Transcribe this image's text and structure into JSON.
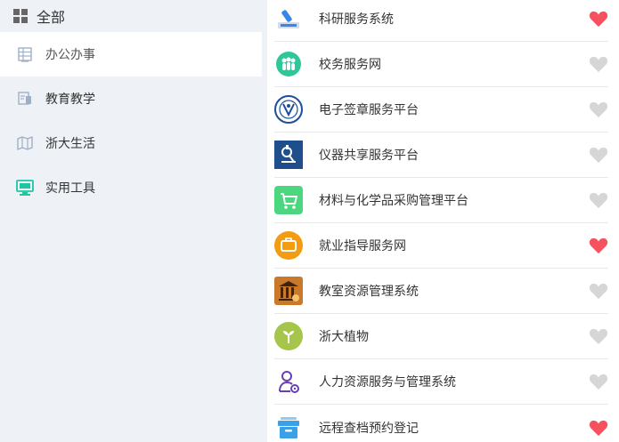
{
  "sidebar": {
    "all_label": "全部",
    "items": [
      {
        "label": "办公办事",
        "icon": "table-icon",
        "active": true
      },
      {
        "label": "教育教学",
        "icon": "board-icon",
        "active": false
      },
      {
        "label": "浙大生活",
        "icon": "map-icon",
        "active": false
      },
      {
        "label": "实用工具",
        "icon": "monitor-tool-icon",
        "active": false
      }
    ]
  },
  "services": [
    {
      "name": "科研服务系统",
      "icon": "microscope-icon",
      "favorited": true
    },
    {
      "name": "校务服务网",
      "icon": "people-circle-icon",
      "favorited": false
    },
    {
      "name": "电子签章服务平台",
      "icon": "university-seal-icon",
      "favorited": false
    },
    {
      "name": "仪器共享服务平台",
      "icon": "microscope-square-icon",
      "favorited": false
    },
    {
      "name": "材料与化学品采购管理平台",
      "icon": "cart-icon",
      "favorited": false
    },
    {
      "name": "就业指导服务网",
      "icon": "briefcase-icon",
      "favorited": true
    },
    {
      "name": "教室资源管理系统",
      "icon": "classroom-icon",
      "favorited": false
    },
    {
      "name": "浙大植物",
      "icon": "sprout-icon",
      "favorited": false
    },
    {
      "name": "人力资源服务与管理系统",
      "icon": "person-gear-icon",
      "favorited": false
    },
    {
      "name": "远程查档预约登记",
      "icon": "archive-box-icon",
      "favorited": true
    }
  ],
  "colors": {
    "heart_active": "#f5515f",
    "heart_inactive": "#d6d6d6",
    "sidebar_bg": "#eef2f7"
  }
}
